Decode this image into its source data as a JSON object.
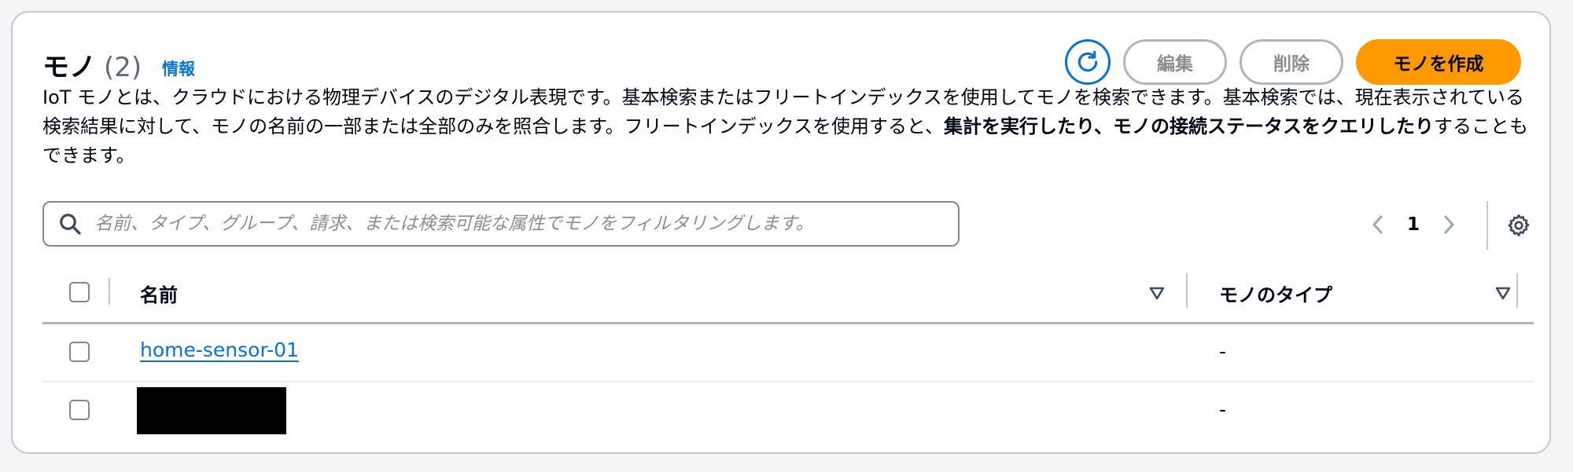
{
  "header": {
    "title": "モノ",
    "count": "(2)",
    "info_link": "情報",
    "refresh_icon": "refresh-icon",
    "edit_label": "編集",
    "delete_label": "削除",
    "create_label": "モノを作成"
  },
  "description": {
    "part1": "IoT モノとは、クラウドにおける物理デバイスのデジタル表現です。基本検索またはフリートインデックスを使用してモノを検索できます。基本検索では、現在表示されている検索結果に対して、モノの名前の一部または全部のみを照合します。フリートインデックスを使用すると、",
    "bold": "集計を実行したり、モノの接続ステータスをクエリしたり",
    "part2": "することもできます。"
  },
  "search": {
    "placeholder": "名前、タイプ、グループ、請求、または検索可能な属性でモノをフィルタリングします。",
    "value": ""
  },
  "pagination": {
    "current_page": "1"
  },
  "table": {
    "columns": [
      {
        "label": "名前"
      },
      {
        "label": "モノのタイプ"
      }
    ],
    "rows": [
      {
        "name": "home-sensor-01",
        "type": "-",
        "redacted": false
      },
      {
        "name": "",
        "type": "-",
        "redacted": true
      }
    ]
  },
  "colors": {
    "primary": "#ff9900",
    "link": "#0972d3",
    "border": "#c6c6cd",
    "disabled": "#8c8c94"
  }
}
